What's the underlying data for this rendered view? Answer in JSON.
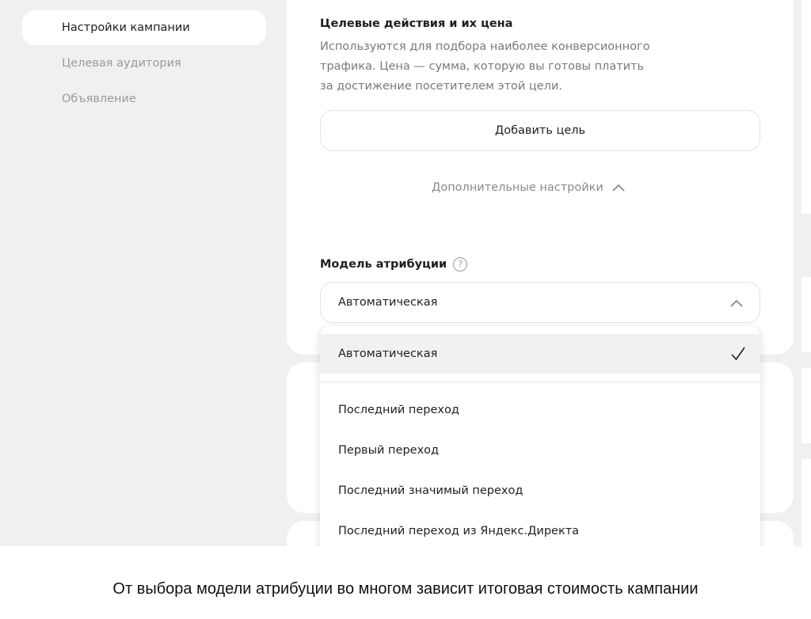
{
  "sidebar": {
    "items": [
      {
        "label": "Настройки кампании",
        "active": true
      },
      {
        "label": "Целевая аудитория",
        "active": false
      },
      {
        "label": "Объявление",
        "active": false
      }
    ]
  },
  "goals": {
    "title": "Целевые действия и их цена",
    "description_lines": [
      "Используются для подбора наиболее конверсионного",
      "трафика. Цена — сумма, которую вы готовы платить",
      "за достижение посетителем этой цели."
    ],
    "add_button_label": "Добавить цель"
  },
  "advanced": {
    "label": "Дополнительные настройки",
    "icon": "chevron-up-icon"
  },
  "attribution": {
    "label": "Модель атрибуции",
    "help_icon": "question-circle-icon",
    "help_glyph": "?",
    "selected_value": "Автоматическая",
    "options": [
      {
        "label": "Автоматическая",
        "selected": true
      },
      {
        "label": "Последний переход",
        "selected": false
      },
      {
        "label": "Первый переход",
        "selected": false
      },
      {
        "label": "Последний значимый переход",
        "selected": false
      },
      {
        "label": "Последний переход из Яндекс.Директа",
        "selected": false
      }
    ]
  },
  "caption": "От выбора модели атрибуции во многом зависит итоговая стоимость кампании",
  "colors": {
    "background": "#f0f0f0",
    "card": "#ffffff",
    "muted_text": "#9a9a9a",
    "selected_option": "#f1f1f3"
  }
}
